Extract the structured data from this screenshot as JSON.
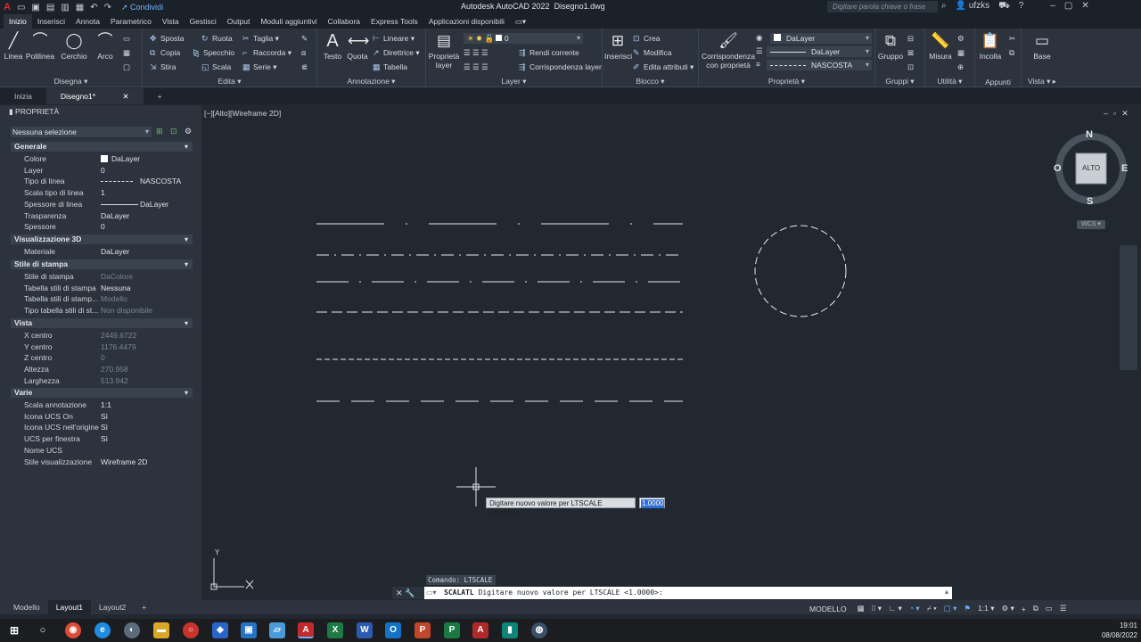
{
  "titlebar": {
    "app_title": "Autodesk AutoCAD 2022",
    "file_title": "Disegno1.dwg",
    "share_label": "Condividi",
    "search_placeholder": "Digitare parola chiave o frase",
    "user": "ufzks"
  },
  "menu_tabs": [
    "Inizio",
    "Inserisci",
    "Annota",
    "Parametrico",
    "Vista",
    "Gestisci",
    "Output",
    "Moduli aggiuntivi",
    "Collabora",
    "Express Tools",
    "Applicazioni disponibili"
  ],
  "ribbon": {
    "draw": {
      "title": "Disegna",
      "line": "Linea",
      "polyline": "Polilinea",
      "circle": "Cerchio",
      "arc": "Arco"
    },
    "modify": {
      "title": "Edita",
      "move": "Sposta",
      "rotate": "Ruota",
      "trim": "Taglia",
      "copy": "Copia",
      "mirror": "Specchio",
      "fillet": "Raccorda",
      "stretch": "Stira",
      "scale": "Scala",
      "array": "Serie"
    },
    "annotation": {
      "title": "Annotazione",
      "text": "Testo",
      "dimension": "Quota",
      "linear": "Lineare",
      "leader": "Direttrice",
      "table": "Tabella"
    },
    "layers": {
      "title": "Layer",
      "properties": "Proprietà",
      "properties2": "layer",
      "current_layer": "0",
      "make_current": "Rendi corrente",
      "match_layer": "Corrispondenza layer"
    },
    "block": {
      "title": "Blocco",
      "insert": "Inserisci",
      "create": "Crea",
      "edit": "Modifica",
      "edit_attributes": "Edita attributi"
    },
    "properties": {
      "title": "Proprietà",
      "match": "Corrispondenza",
      "match2": "con proprietà",
      "color": "DaLayer",
      "lineweight": "DaLayer",
      "linetype": "NASCOSTA"
    },
    "groups": {
      "title": "Gruppi",
      "group": "Gruppo"
    },
    "utilities": {
      "title": "Utilità",
      "measure": "Misura"
    },
    "clipboard": {
      "title": "Appunti",
      "paste": "Incolla"
    },
    "view": {
      "title": "Vista",
      "base": "Base"
    }
  },
  "file_tabs": [
    "Inizia",
    "Disegno1*"
  ],
  "palette": {
    "title": "PROPRIETÀ",
    "selection": "Nessuna selezione",
    "groups": {
      "general": "Generale",
      "view3d": "Visualizzazione 3D",
      "plotstyle": "Stile di stampa",
      "view": "Vista",
      "misc": "Varie"
    },
    "general": [
      {
        "k": "Colore",
        "v": "DaLayer"
      },
      {
        "k": "Layer",
        "v": "0"
      },
      {
        "k": "Tipo di linea",
        "v": "NASCOSTA"
      },
      {
        "k": "Scala tipo di linea",
        "v": "1"
      },
      {
        "k": "Spessore di linea",
        "v": "DaLayer"
      },
      {
        "k": "Trasparenza",
        "v": "DaLayer"
      },
      {
        "k": "Spessore",
        "v": "0"
      }
    ],
    "view3d": [
      {
        "k": "Materiale",
        "v": "DaLayer"
      }
    ],
    "plotstyle": [
      {
        "k": "Stile di stampa",
        "v": "DaColore"
      },
      {
        "k": "Tabella stili di stampa",
        "v": "Nessuna"
      },
      {
        "k": "Tabella stili di stamp...",
        "v": "Modello"
      },
      {
        "k": "Tipo tabella stili di st...",
        "v": "Non disponibile"
      }
    ],
    "view": [
      {
        "k": "X centro",
        "v": "2449.6722"
      },
      {
        "k": "Y centro",
        "v": "1176.4479"
      },
      {
        "k": "Z centro",
        "v": "0"
      },
      {
        "k": "Altezza",
        "v": "270.958"
      },
      {
        "k": "Larghezza",
        "v": "513.942"
      }
    ],
    "misc": [
      {
        "k": "Scala annotazione",
        "v": "1:1"
      },
      {
        "k": "Icona UCS On",
        "v": "Sì"
      },
      {
        "k": "Icona UCS nell'origine",
        "v": "Sì"
      },
      {
        "k": "UCS per finestra",
        "v": "Sì"
      },
      {
        "k": "Nome UCS",
        "v": ""
      },
      {
        "k": "Stile visualizzazione",
        "v": "Wireframe 2D"
      }
    ]
  },
  "viewport": {
    "label": "[−][Alto][Wireframe 2D]",
    "compass": {
      "n": "N",
      "s": "S",
      "e": "E",
      "w": "O",
      "face": "ALTO",
      "ucs": "WCS"
    },
    "ucs_y": "Y"
  },
  "dynamic_input": {
    "prompt": "Digitare nuovo valore per LTSCALE <1.0000>:",
    "value": "1.0000"
  },
  "command": {
    "history": "Comando: LTSCALE",
    "current_cmd": "SCALATL",
    "current_prompt": "Digitare nuovo valore per LTSCALE <1.0000>:"
  },
  "layout_tabs": [
    "Modello",
    "Layout1",
    "Layout2"
  ],
  "status": {
    "model": "MODELLO",
    "scale": "1:1"
  },
  "clock": {
    "time": "19:01",
    "date": "08/08/2022"
  },
  "colors": {
    "background": "#212830",
    "panel": "#2c333d",
    "accent": "#2f6fd8",
    "autocad_red": "#e0252c"
  }
}
